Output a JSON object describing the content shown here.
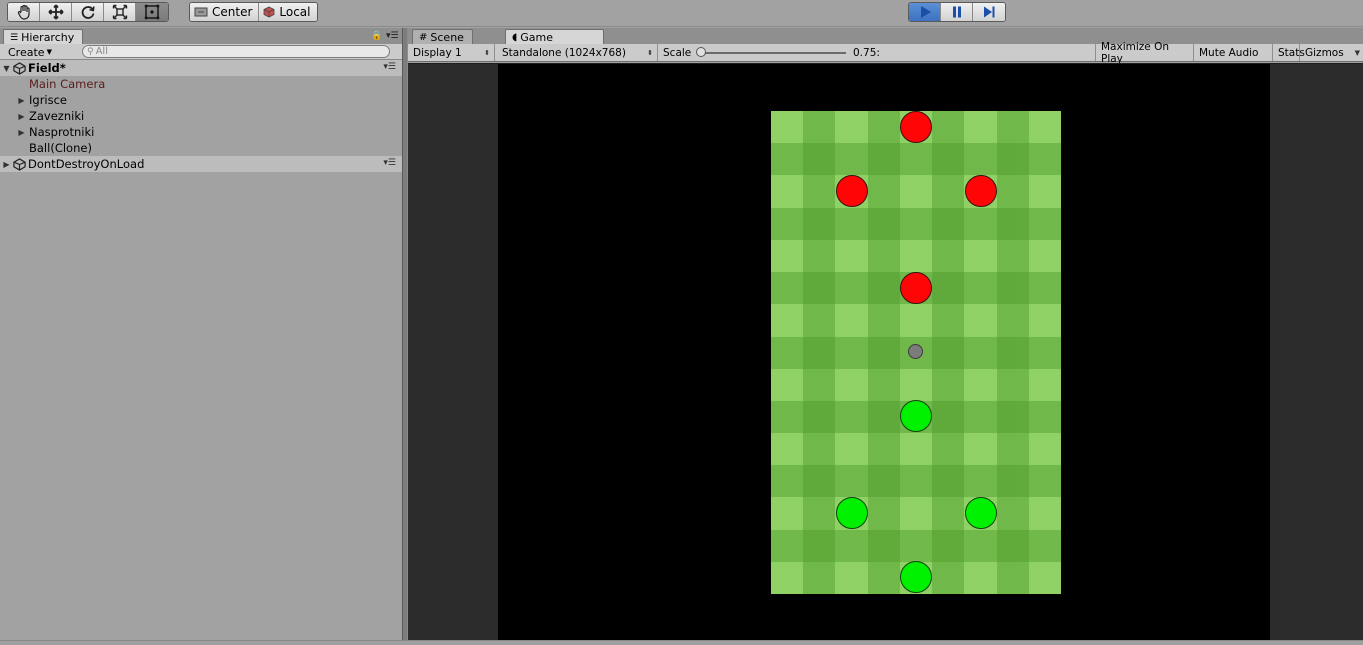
{
  "toolbar": {
    "transform_tools": [
      "hand-tool",
      "move-tool",
      "rotate-tool",
      "scale-tool",
      "rect-tool"
    ],
    "pivot_mode_label": "Center",
    "pivot_rotation_label": "Local",
    "play_controls": [
      "play",
      "pause",
      "step"
    ]
  },
  "hierarchy": {
    "tab_label": "Hierarchy",
    "create_label": "Create",
    "search_placeholder": "All",
    "scene_name": "Field*",
    "items": [
      {
        "label": "Main Camera",
        "expandable": false
      },
      {
        "label": "Igrisce",
        "expandable": true
      },
      {
        "label": "Zavezniki",
        "expandable": true
      },
      {
        "label": "Nasprotniki",
        "expandable": true
      },
      {
        "label": "Ball(Clone)",
        "expandable": false
      }
    ],
    "dont_destroy_label": "DontDestroyOnLoad"
  },
  "tabs": {
    "scene_label": "Scene",
    "game_label": "Game"
  },
  "game_toolbar": {
    "display_label": "Display 1",
    "resolution_label": "Standalone (1024x768)",
    "scale_label": "Scale",
    "scale_value": "0.75:",
    "maximize_label": "Maximize On Play",
    "mute_label": "Mute Audio",
    "stats_label": "Stats",
    "gizmos_label": "Gizmos"
  },
  "colors": {
    "team_red": "#ff0505",
    "team_green": "#00f100",
    "ball": "#7c7c7c",
    "grass_light": "#8fd165",
    "grass_dark": "#4d9b2a",
    "play_active": "#3d72c2"
  }
}
